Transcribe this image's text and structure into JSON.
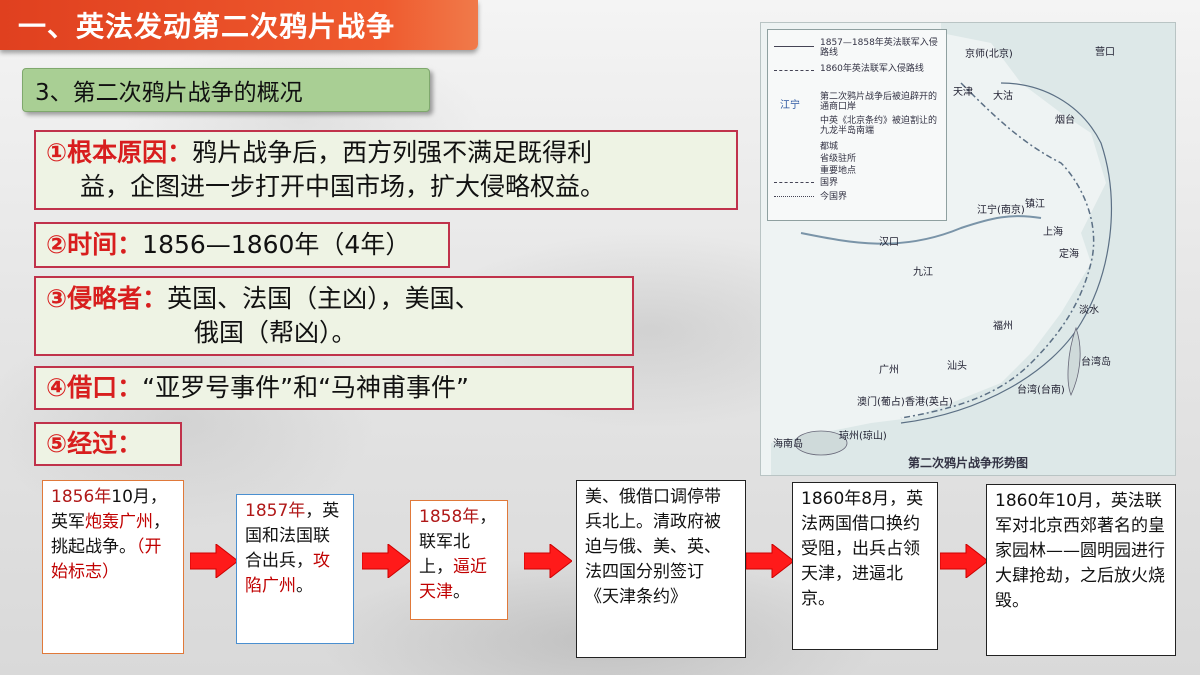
{
  "title": "一、英法发动第二次鸦片战争",
  "section": "3、第二次鸦片战争的概况",
  "boxes": {
    "cause_label": "①根本原因：",
    "cause_line1": "鸦片战争后，西方列强不满足既得利",
    "cause_line2": "益，企图进一步打开中国市场，扩大侵略权益。",
    "time_label": "②时间：",
    "time_value": "1856—1860年（4年）",
    "aggressor_label": "③侵略者：",
    "aggressor_line1": "英国、法国（主凶），美国、",
    "aggressor_line2": "俄国（帮凶）。",
    "pretext_label": "④借口：",
    "pretext_value": "“亚罗号事件”和“马神甫事件”",
    "process_label": "⑤经过："
  },
  "map": {
    "caption": "第二次鸦片战争形势图",
    "legend": [
      "1857—1858年英法联军入侵路线",
      "1860年英法联军入侵路线",
      "第二次鸦片战争后被迫辟开的通商口岸",
      "中英《北京条约》被迫割让的九龙半岛南端",
      "都城",
      "省级驻所",
      "重要地点",
      "国界",
      "今国界"
    ],
    "legend_sample": "江宁",
    "places": [
      "京师(北京)",
      "营口",
      "天津",
      "大沽",
      "烟台",
      "镇江",
      "江宁(南京)",
      "汉口",
      "九江",
      "上海",
      "定海",
      "福州",
      "淡水",
      "汕头",
      "广州",
      "澳门(葡占)",
      "香港(英占)",
      "台湾(台南)",
      "琼州(琼山)",
      "海南岛",
      "台湾岛"
    ]
  },
  "steps": {
    "s1": {
      "a": "1856年",
      "b": "10",
      "c": "月，英军",
      "d": "炮轰广州",
      "e": "，挑起战争。",
      "f": "（开始标志）"
    },
    "s2": {
      "a": "1857年",
      "b": "，英国和法国联合出兵，",
      "c": "攻陷广州",
      "d": "。"
    },
    "s3": {
      "a": "1858年",
      "b": "，联军北上，",
      "c": "逼近天津",
      "d": "。"
    },
    "s4": {
      "text": "美、俄借口调停带兵北上。清政府被迫与俄、美、英、法四国分别签订《天津条约》"
    },
    "s5": {
      "text": "1860年8月，英法两国借口换约受阻，出兵占领天津，进逼北京。"
    },
    "s6": {
      "text": "1860年10月，英法联军对北京西郊著名的皇家园林——圆明园进行大肆抢劫，之后放火烧毁。"
    }
  },
  "colors": {
    "title_bg": "#e0401f",
    "section_bg": "#a9cf94",
    "box_border": "#c0324b",
    "label_red": "#d81e1e",
    "arrow_red": "#ff1a1a"
  }
}
